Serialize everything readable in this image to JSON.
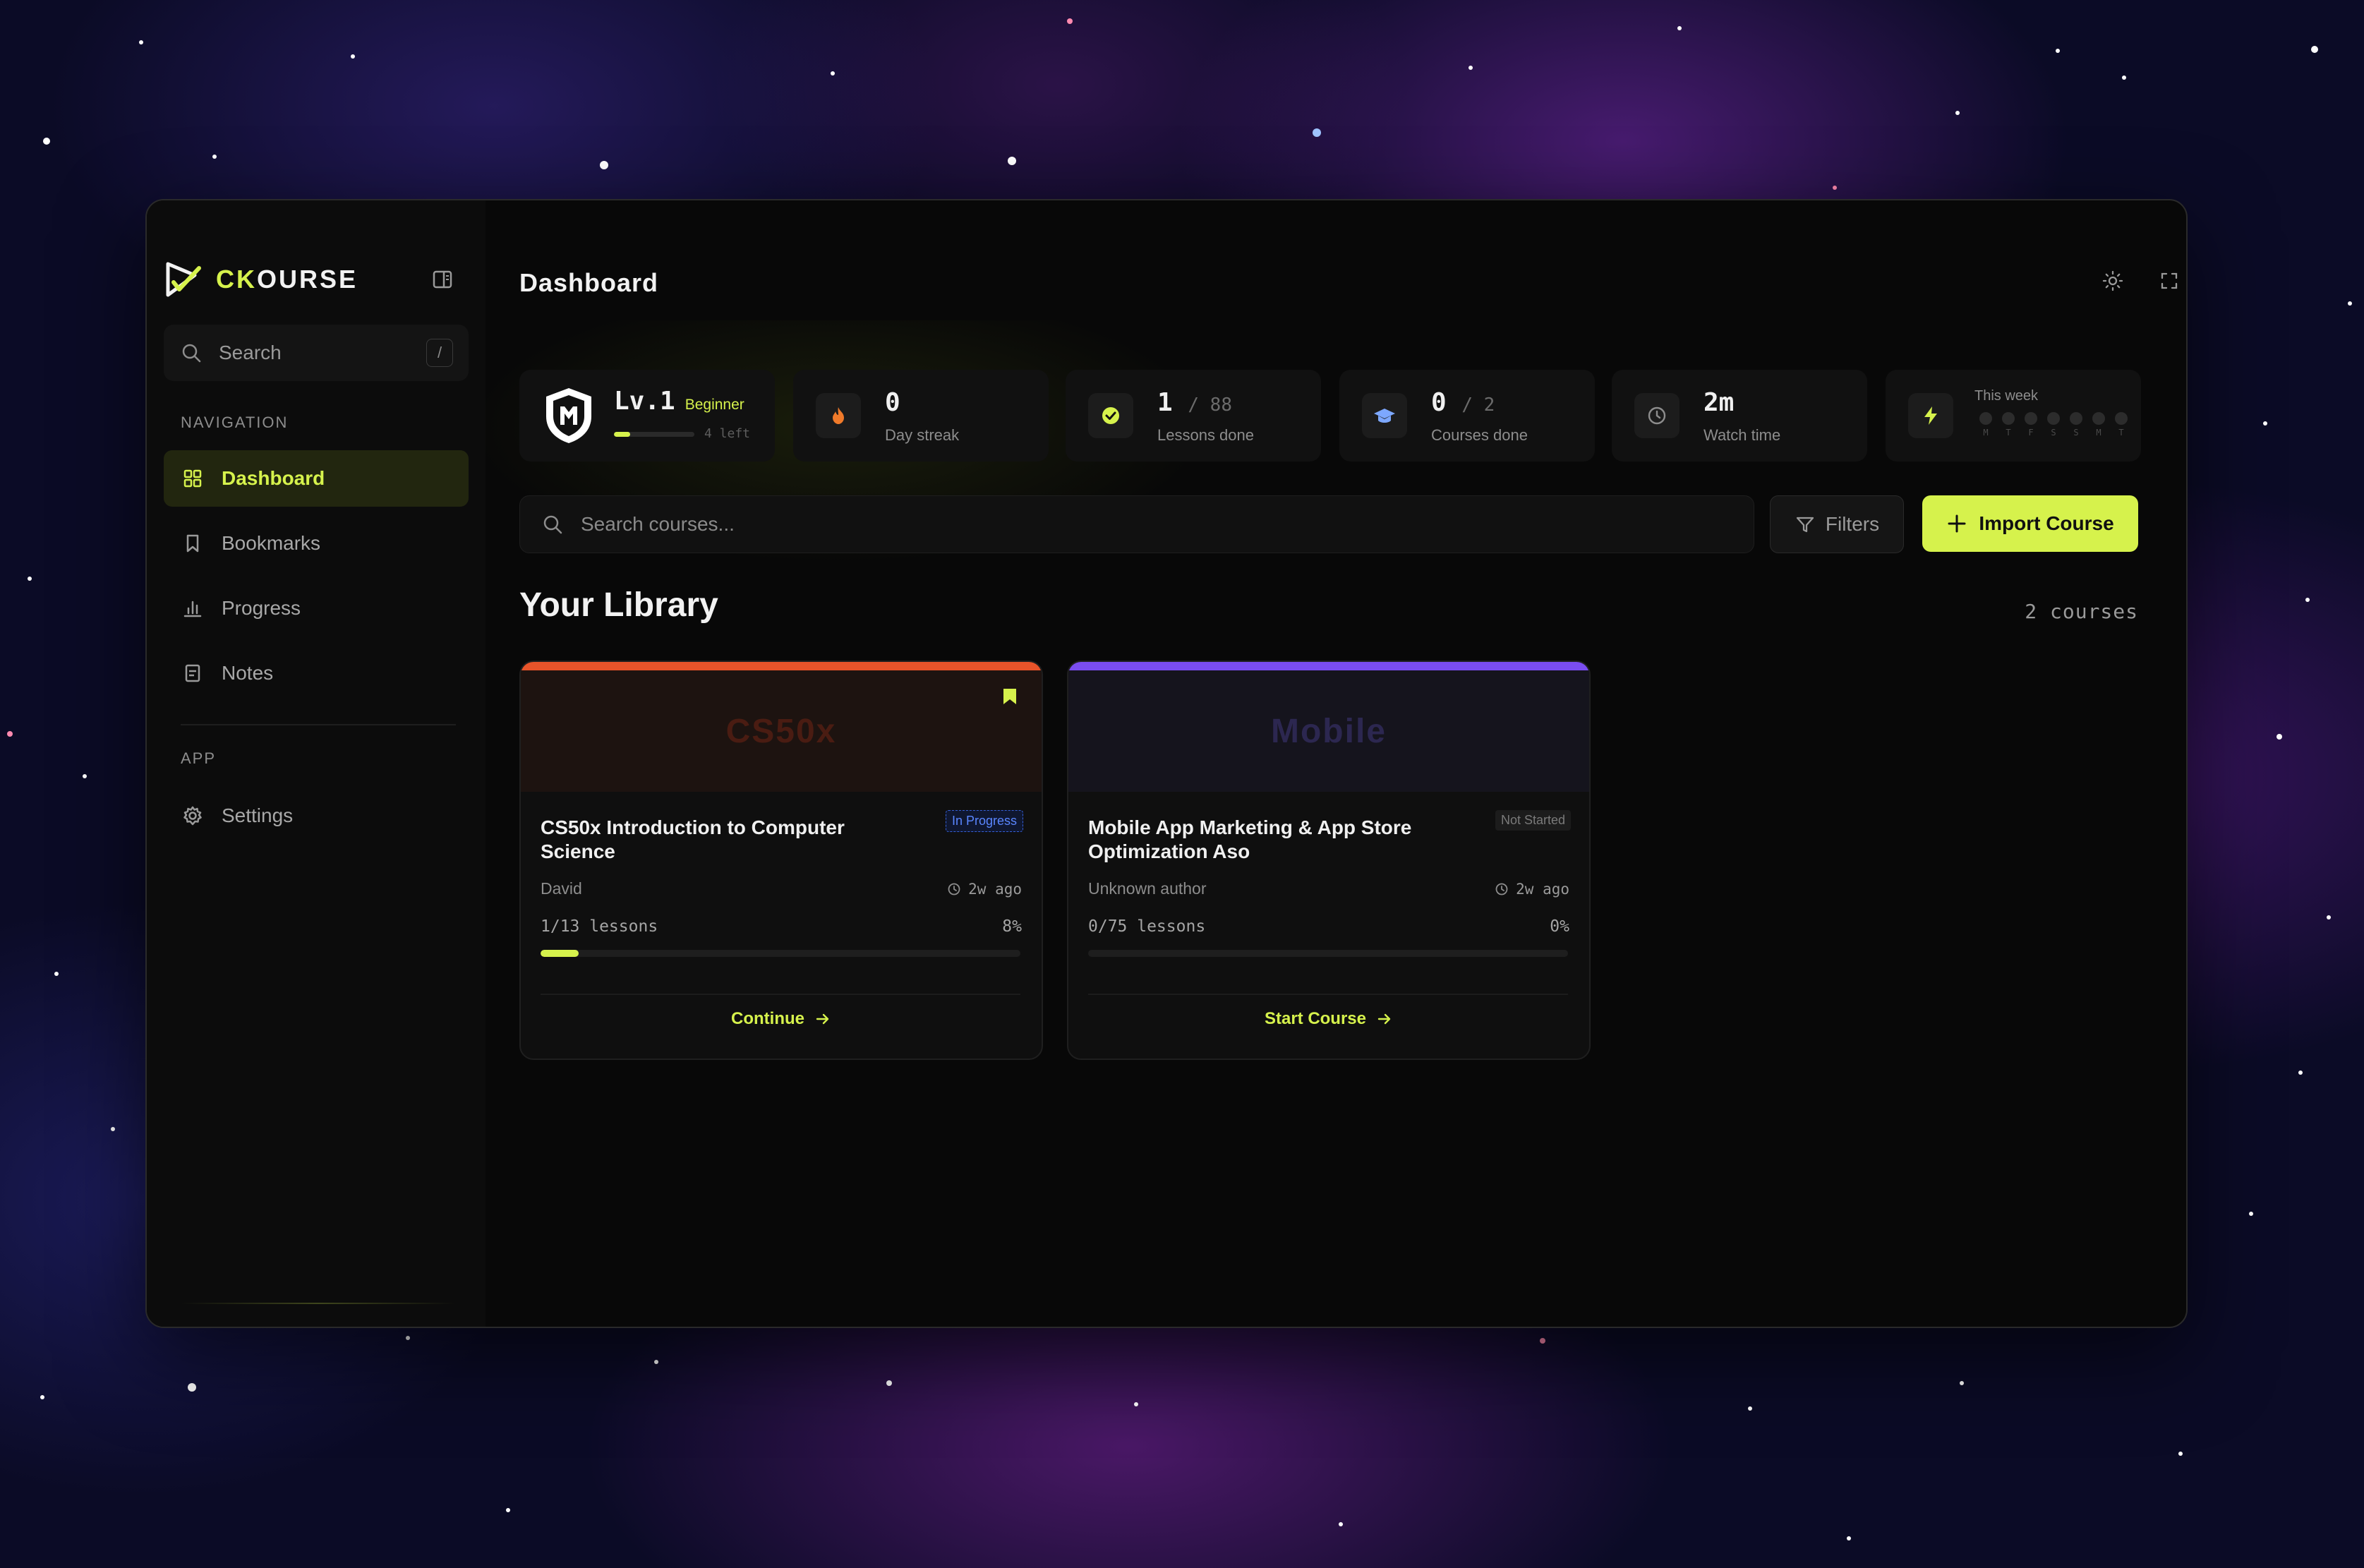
{
  "app": {
    "name_accent": "CK",
    "name_rest": "OURSE"
  },
  "sidebar": {
    "search_label": "Search",
    "search_shortcut": "/",
    "nav_section": "NAVIGATION",
    "nav_items": [
      {
        "label": "Dashboard",
        "icon": "grid-icon",
        "active": true
      },
      {
        "label": "Bookmarks",
        "icon": "bookmark-icon",
        "active": false
      },
      {
        "label": "Progress",
        "icon": "bar-chart-icon",
        "active": false
      },
      {
        "label": "Notes",
        "icon": "note-icon",
        "active": false
      }
    ],
    "app_section": "APP",
    "app_items": [
      {
        "label": "Settings",
        "icon": "gear-icon"
      }
    ]
  },
  "header": {
    "title": "Dashboard",
    "icons": [
      "sun-icon",
      "fullscreen-icon"
    ]
  },
  "stats": {
    "level": {
      "value": "Lv.1",
      "rank": "Beginner",
      "left": "4 left",
      "progress": 0.2
    },
    "streak": {
      "value": "0",
      "caption": "Day streak"
    },
    "lessons": {
      "value": "1",
      "total": "/ 88",
      "caption": "Lessons done"
    },
    "courses": {
      "value": "0",
      "total": "/ 2",
      "caption": "Courses done"
    },
    "watch": {
      "value": "2m",
      "caption": "Watch time"
    },
    "week": {
      "caption": "This week",
      "days": [
        "M",
        "T",
        "F",
        "S",
        "S",
        "M",
        "T"
      ]
    }
  },
  "toolbar": {
    "search_placeholder": "Search courses...",
    "filters_label": "Filters",
    "import_label": "Import Course"
  },
  "library": {
    "title": "Your Library",
    "count": "2 courses",
    "courses": [
      {
        "banner": "CS50x",
        "title": "CS50x Introduction to Computer Science",
        "status": "In Progress",
        "author": "David",
        "ago": "2w ago",
        "lessons": "1/13 lessons",
        "percent": "8%",
        "progress": 0.08,
        "action": "Continue",
        "bookmarked": true,
        "accent": "#e8542a"
      },
      {
        "banner": "Mobile",
        "title": "Mobile App Marketing & App Store Optimization Aso",
        "status": "Not Started",
        "author": "Unknown author",
        "ago": "2w ago",
        "lessons": "0/75 lessons",
        "percent": "0%",
        "progress": 0,
        "action": "Start Course",
        "bookmarked": false,
        "accent": "#7a4df0"
      }
    ]
  },
  "colors": {
    "accent": "#d6f24c",
    "window_bg": "#080808",
    "in_progress": "#4a7dff"
  }
}
